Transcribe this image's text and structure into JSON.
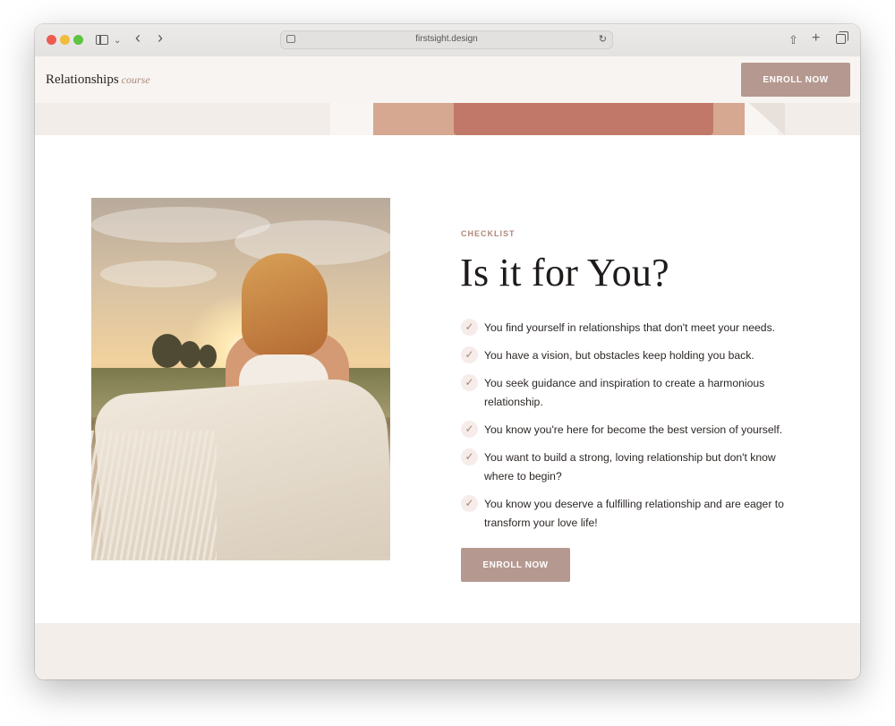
{
  "browser": {
    "url": "firstsight.design"
  },
  "header": {
    "logo_main": "Relationships",
    "logo_script": "course",
    "enroll_label": "ENROLL NOW"
  },
  "section": {
    "eyebrow": "CHECKLIST",
    "title": "Is it for You?",
    "items": [
      "You find yourself in relationships that don't meet your needs.",
      "You have a vision, but obstacles keep holding you back.",
      "You seek guidance and inspiration to create a harmonious relationship.",
      "You know you're here for become the best version of yourself.",
      "You want to build a strong, loving relationship but don't know where to begin?",
      "You know you deserve a fulfilling relationship and are eager to transform your love life!"
    ],
    "check_symbol": "✓",
    "enroll_label": "ENROLL NOW"
  },
  "colors": {
    "accent": "#b59990",
    "eyebrow": "#b0897a",
    "header_bg": "#f8f4f1",
    "footer_bg": "#f3eeea"
  }
}
